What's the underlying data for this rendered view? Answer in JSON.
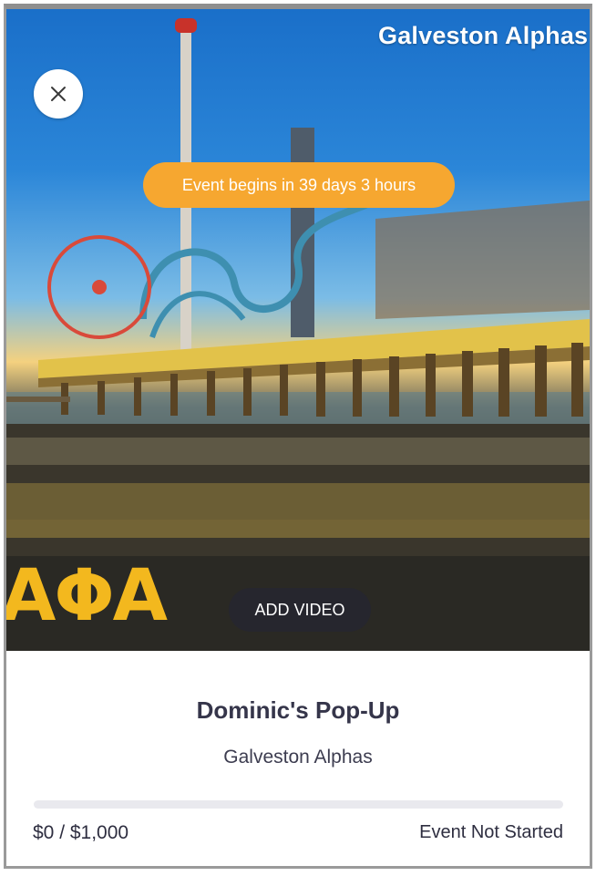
{
  "hero": {
    "brand_text": "Galveston Alphas",
    "countdown": "Event begins in 39 days 3 hours",
    "greek_letters": "ΑΦΑ",
    "add_video_label": "ADD VIDEO",
    "close_icon": "close-icon"
  },
  "event": {
    "title": "Dominic's Pop-Up",
    "organization": "Galveston Alphas",
    "amount": "$0 / $1,000",
    "progress_percent": 0,
    "status": "Event Not Started"
  },
  "colors": {
    "accent": "#f6a730",
    "title_text": "#35354a",
    "track": "#e9e9ee"
  }
}
